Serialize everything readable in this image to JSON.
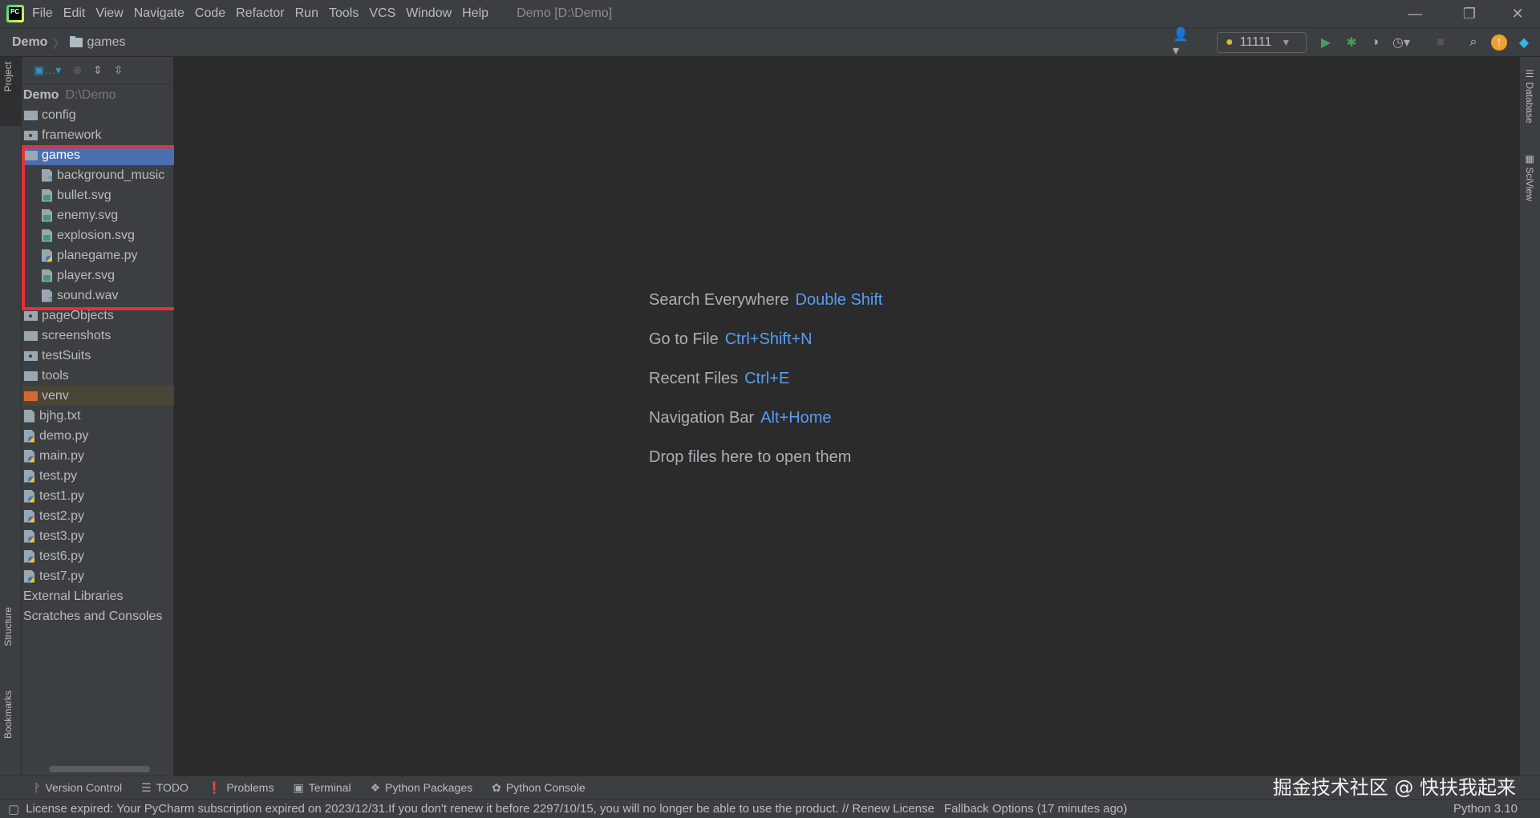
{
  "window": {
    "title": "Demo [D:\\Demo]",
    "logo_text": "PC"
  },
  "menu": [
    "File",
    "Edit",
    "View",
    "Navigate",
    "Code",
    "Refactor",
    "Run",
    "Tools",
    "VCS",
    "Window",
    "Help"
  ],
  "breadcrumb": {
    "project": "Demo",
    "folder": "games"
  },
  "toolbar": {
    "run_config": "11111"
  },
  "left_tabs": {
    "project": "Project",
    "structure": "Structure",
    "bookmarks": "Bookmarks"
  },
  "right_tabs": {
    "database": "Database",
    "sciview": "SciView"
  },
  "tree": {
    "root": {
      "name": "Demo",
      "path": "D:\\Demo"
    },
    "items": [
      {
        "label": "config",
        "kind": "folder",
        "depth": 1
      },
      {
        "label": "framework",
        "kind": "module",
        "depth": 1
      },
      {
        "label": "games",
        "kind": "folder",
        "depth": 1,
        "selected": true
      },
      {
        "label": "background_music",
        "kind": "unknown",
        "depth": 2
      },
      {
        "label": "bullet.svg",
        "kind": "image",
        "depth": 2
      },
      {
        "label": "enemy.svg",
        "kind": "image",
        "depth": 2
      },
      {
        "label": "explosion.svg",
        "kind": "image",
        "depth": 2
      },
      {
        "label": "planegame.py",
        "kind": "python",
        "depth": 2
      },
      {
        "label": "player.svg",
        "kind": "image",
        "depth": 2
      },
      {
        "label": "sound.wav",
        "kind": "unknown",
        "depth": 2
      },
      {
        "label": "pageObjects",
        "kind": "module",
        "depth": 1
      },
      {
        "label": "screenshots",
        "kind": "folder",
        "depth": 1
      },
      {
        "label": "testSuits",
        "kind": "module",
        "depth": 1
      },
      {
        "label": "tools",
        "kind": "folder",
        "depth": 1
      },
      {
        "label": "venv",
        "kind": "excluded",
        "depth": 1
      },
      {
        "label": "bjhg.txt",
        "kind": "text",
        "depth": 1
      },
      {
        "label": "demo.py",
        "kind": "python",
        "depth": 1
      },
      {
        "label": "main.py",
        "kind": "python",
        "depth": 1
      },
      {
        "label": "test.py",
        "kind": "python",
        "depth": 1
      },
      {
        "label": "test1.py",
        "kind": "python",
        "depth": 1
      },
      {
        "label": "test2.py",
        "kind": "python",
        "depth": 1
      },
      {
        "label": "test3.py",
        "kind": "python",
        "depth": 1
      },
      {
        "label": "test6.py",
        "kind": "python",
        "depth": 1
      },
      {
        "label": "test7.py",
        "kind": "python",
        "depth": 1
      },
      {
        "label": "External Libraries",
        "kind": "none",
        "depth": 0
      },
      {
        "label": "Scratches and Consoles",
        "kind": "none",
        "depth": 0
      }
    ]
  },
  "editor_hints": [
    {
      "text": "Search Everywhere",
      "key": "Double Shift"
    },
    {
      "text": "Go to File",
      "key": "Ctrl+Shift+N"
    },
    {
      "text": "Recent Files",
      "key": "Ctrl+E"
    },
    {
      "text": "Navigation Bar",
      "key": "Alt+Home"
    },
    {
      "text": "Drop files here to open them",
      "key": ""
    }
  ],
  "tool_windows": [
    "Version Control",
    "TODO",
    "Problems",
    "Terminal",
    "Python Packages",
    "Python Console"
  ],
  "status": {
    "message": "License expired: Your PyCharm subscription expired on 2023/12/31.If you don't renew it before 2297/10/15, you will no longer be able to use the product. // Renew License",
    "fallback": "Fallback Options (17 minutes ago)",
    "interpreter": "Python 3.10"
  },
  "watermark": "掘金技术社区 @ 快扶我起来",
  "colors": {
    "selection": "#4b6eaf",
    "highlight_box": "#e8303a",
    "shortcut": "#589df6",
    "run": "#499c54"
  }
}
